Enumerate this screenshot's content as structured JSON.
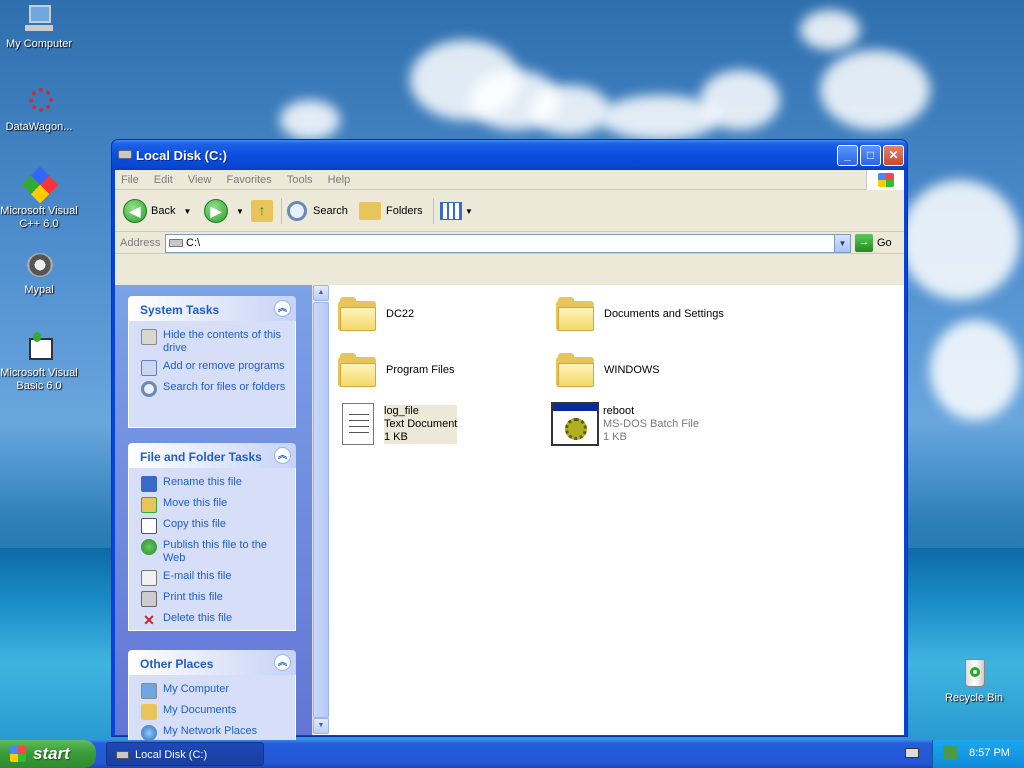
{
  "desktop": {
    "icons": [
      {
        "label": "My Computer",
        "icon": "my-computer-icon"
      },
      {
        "label": "DataWagon...",
        "icon": "datawagon-shortcut-icon"
      },
      {
        "label": "Microsoft Visual C++ 6.0",
        "icon": "visual-cpp-shortcut-icon"
      },
      {
        "label": "Mypal",
        "icon": "mypal-shortcut-icon"
      },
      {
        "label": "Microsoft Visual Basic 6.0",
        "icon": "visual-basic-shortcut-icon"
      }
    ],
    "recycle_bin": "Recycle Bin"
  },
  "window": {
    "title": "Local Disk (C:)",
    "menu": [
      "File",
      "Edit",
      "View",
      "Favorites",
      "Tools",
      "Help"
    ],
    "toolbar": {
      "back": "Back",
      "search": "Search",
      "folders": "Folders"
    },
    "address": {
      "label": "Address",
      "value": "C:\\",
      "go": "Go"
    }
  },
  "left_pane": {
    "system_tasks": {
      "title": "System Tasks",
      "items": [
        "Hide the contents of this drive",
        "Add or remove programs",
        "Search for files or folders"
      ]
    },
    "file_tasks": {
      "title": "File and Folder Tasks",
      "items": [
        "Rename this file",
        "Move this file",
        "Copy this file",
        "Publish this file to the Web",
        "E-mail this file",
        "Print this file",
        "Delete this file"
      ]
    },
    "other_places": {
      "title": "Other Places",
      "items": [
        "My Computer",
        "My Documents",
        "My Network Places"
      ]
    }
  },
  "files": [
    {
      "name": "DC22",
      "type": "folder"
    },
    {
      "name": "Documents and Settings",
      "type": "folder"
    },
    {
      "name": "Program Files",
      "type": "folder"
    },
    {
      "name": "WINDOWS",
      "type": "folder"
    },
    {
      "name": "log_file",
      "type_label": "Text Document",
      "size": "1 KB"
    },
    {
      "name": "reboot",
      "type_label": "MS-DOS Batch File",
      "size": "1 KB"
    }
  ],
  "taskbar": {
    "start": "start",
    "task": "Local Disk (C:)",
    "clock": "8:57 PM"
  }
}
